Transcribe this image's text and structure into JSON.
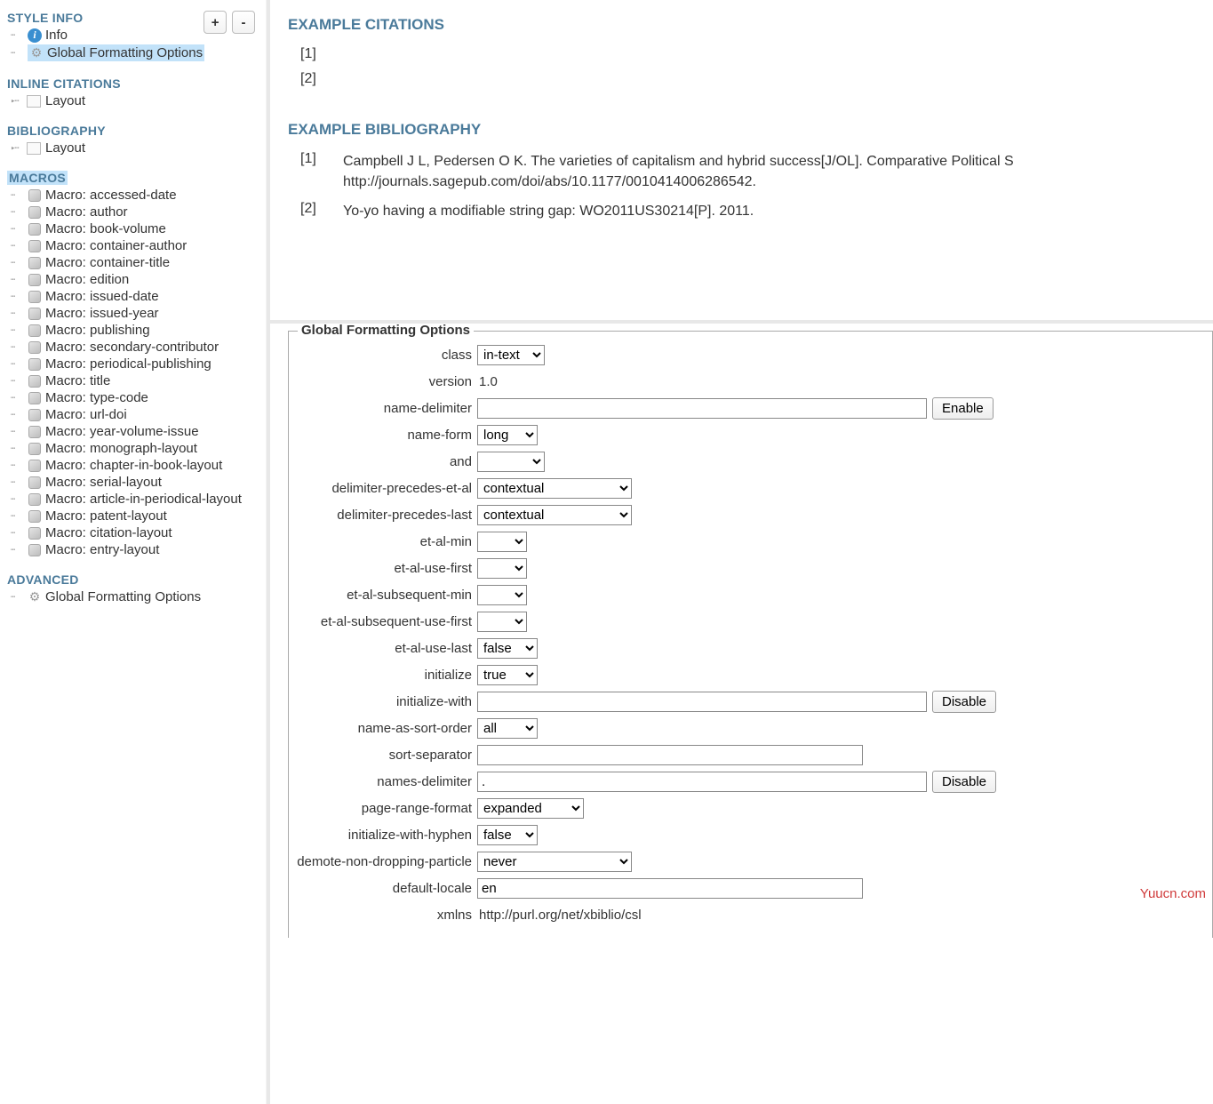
{
  "sidebar": {
    "style_info": {
      "header": "STYLE INFO",
      "plus": "+",
      "minus": "-",
      "info": "Info",
      "global": "Global Formatting Options"
    },
    "inline": {
      "header": "INLINE CITATIONS",
      "layout": "Layout"
    },
    "biblio": {
      "header": "BIBLIOGRAPHY",
      "layout": "Layout"
    },
    "macros": {
      "header": "MACROS",
      "items": [
        "Macro: accessed-date",
        "Macro: author",
        "Macro: book-volume",
        "Macro: container-author",
        "Macro: container-title",
        "Macro: edition",
        "Macro: issued-date",
        "Macro: issued-year",
        "Macro: publishing",
        "Macro: secondary-contributor",
        "Macro: periodical-publishing",
        "Macro: title",
        "Macro: type-code",
        "Macro: url-doi",
        "Macro: year-volume-issue",
        "Macro: monograph-layout",
        "Macro: chapter-in-book-layout",
        "Macro: serial-layout",
        "Macro: article-in-periodical-layout",
        "Macro: patent-layout",
        "Macro: citation-layout",
        "Macro: entry-layout"
      ]
    },
    "advanced": {
      "header": "ADVANCED",
      "global": "Global Formatting Options"
    }
  },
  "preview": {
    "citations_header": "EXAMPLE CITATIONS",
    "cite1": "[1]",
    "cite2": "[2]",
    "biblio_header": "EXAMPLE BIBLIOGRAPHY",
    "bib1_num": "[1]",
    "bib1_txt": "Campbell J L, Pedersen O K. The varieties of capitalism and hybrid success[J/OL]. Comparative Political S http://journals.sagepub.com/doi/abs/10.1177/0010414006286542.",
    "bib2_num": "[2]",
    "bib2_txt": "Yo-yo having a modifiable string gap: WO2011US30214[P]. 2011."
  },
  "form": {
    "legend": "Global Formatting Options",
    "labels": {
      "class": "class",
      "version": "version",
      "name_delim": "name-delimiter",
      "name_form": "name-form",
      "and": "and",
      "del_etal": "delimiter-precedes-et-al",
      "del_last": "delimiter-precedes-last",
      "etal_min": "et-al-min",
      "etal_first": "et-al-use-first",
      "etal_sub_min": "et-al-subsequent-min",
      "etal_sub_first": "et-al-subsequent-use-first",
      "etal_last": "et-al-use-last",
      "init": "initialize",
      "init_with": "initialize-with",
      "sort": "name-as-sort-order",
      "sort_sep": "sort-separator",
      "names_delim": "names-delimiter",
      "page_range": "page-range-format",
      "init_hyph": "initialize-with-hyphen",
      "demote": "demote-non-dropping-particle",
      "locale": "default-locale",
      "xmlns": "xmlns"
    },
    "values": {
      "class": "in-text",
      "version": "1.0",
      "name_delim": "",
      "name_form": "long",
      "and": "",
      "del_etal": "contextual",
      "del_last": "contextual",
      "etal_min": "",
      "etal_first": "",
      "etal_sub_min": "",
      "etal_sub_first": "",
      "etal_last": "false",
      "init": "true",
      "init_with": "",
      "sort": "all",
      "sort_sep": "",
      "names_delim": ".",
      "page_range": "expanded",
      "init_hyph": "false",
      "demote": "never",
      "locale": "en",
      "xmlns": "http://purl.org/net/xbiblio/csl"
    },
    "buttons": {
      "enable": "Enable",
      "disable": "Disable"
    }
  },
  "watermark": "Yuucn.com"
}
